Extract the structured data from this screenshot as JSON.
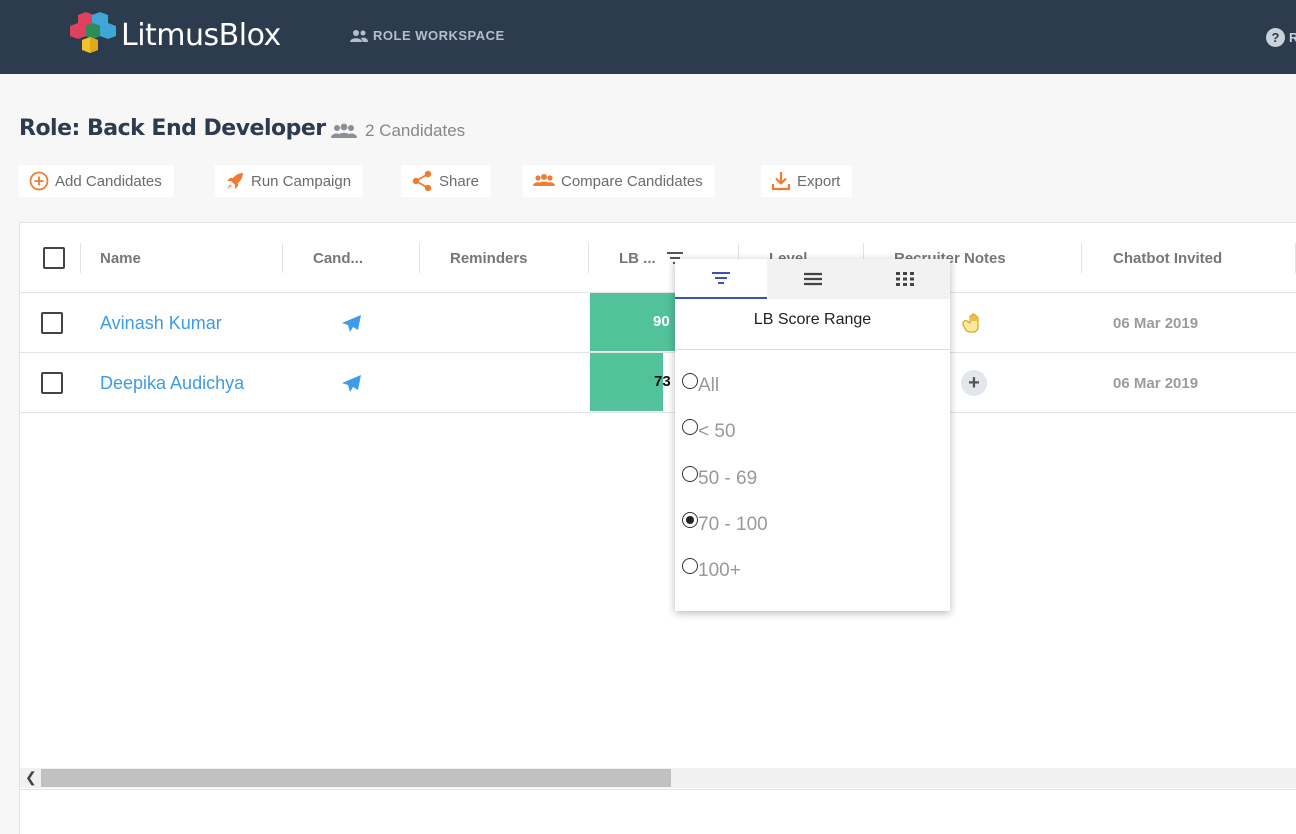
{
  "app": {
    "brand": "LitmusBlox"
  },
  "nav": {
    "workspace_label": "ROLE WORKSPACE",
    "help_label": "R"
  },
  "header": {
    "role_title": "Role: Back End Developer",
    "candidate_count": "2 Candidates"
  },
  "actions": {
    "add": "Add Candidates",
    "run": "Run Campaign",
    "share": "Share",
    "compare": "Compare Candidates",
    "export": "Export"
  },
  "table": {
    "columns": {
      "name": "Name",
      "candidate": "Cand...",
      "reminders": "Reminders",
      "lb": "LB ...",
      "level": "Level",
      "notes": "Recruiter Notes",
      "chatbot": "Chatbot Invited"
    },
    "rows": [
      {
        "name": "Avinash Kumar",
        "lb_score": "90",
        "chatbot_invited": "06 Mar 2019"
      },
      {
        "name": "Deepika Audichya",
        "lb_score": "73",
        "chatbot_invited": "06 Mar 2019"
      }
    ]
  },
  "filter_popup": {
    "title": "LB Score Range",
    "options": [
      {
        "label": "All",
        "selected": false
      },
      {
        "label": "< 50",
        "selected": false
      },
      {
        "label": "50 - 69",
        "selected": false
      },
      {
        "label": "70 - 100",
        "selected": true
      },
      {
        "label": "100+",
        "selected": false
      }
    ]
  },
  "colors": {
    "navbar": "#2d3b4e",
    "accent_orange": "#f07b32",
    "link_blue": "#3d9be9",
    "score_green": "#52c29a"
  }
}
